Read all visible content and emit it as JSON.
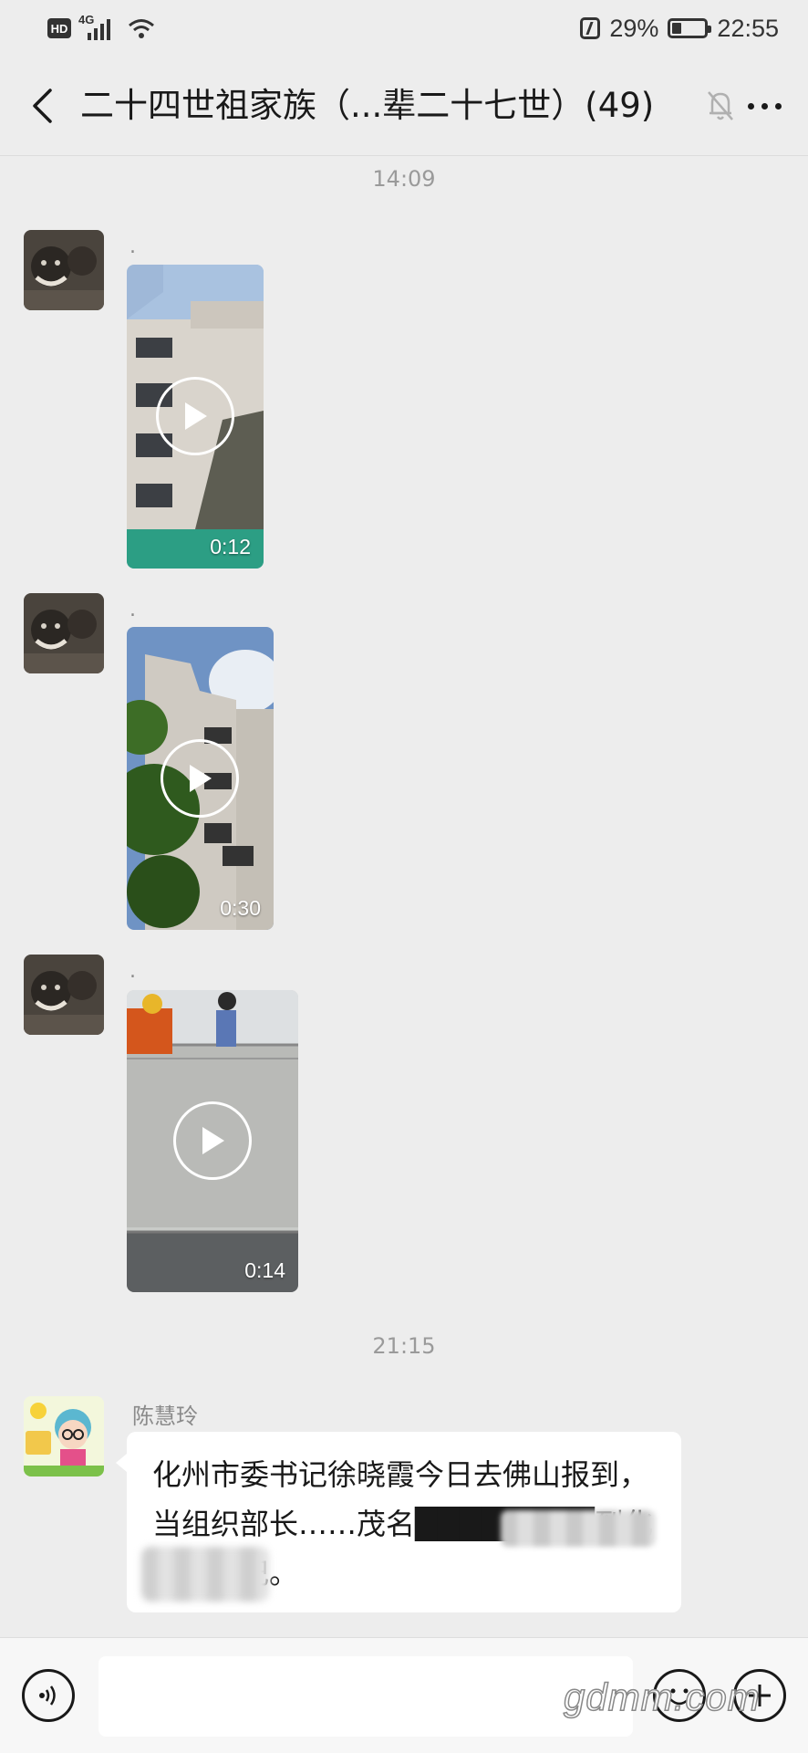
{
  "status_bar": {
    "hd_label": "HD",
    "network_label": "4G",
    "battery_percent": "29%",
    "battery_level": 0.29,
    "time": "22:55",
    "icons": [
      "hd-icon",
      "signal-icon",
      "wifi-icon",
      "nfc-icon",
      "battery-icon"
    ]
  },
  "header": {
    "back_icon": "chevron-left-icon",
    "title": "二十四世祖家族（...辈二十七世）(49)",
    "mute_icon": "bell-off-icon",
    "more_icon": "more-dots-icon"
  },
  "messages": [
    {
      "type": "timestamp",
      "text": "14:09"
    },
    {
      "type": "video",
      "sender_name": ".",
      "duration": "0:12"
    },
    {
      "type": "video",
      "sender_name": ".",
      "duration": "0:30"
    },
    {
      "type": "video",
      "sender_name": ".",
      "duration": "0:14"
    },
    {
      "type": "timestamp",
      "text": "21:15"
    },
    {
      "type": "text",
      "sender_name": "陈慧玲",
      "text": "化州市委书记徐晓霞今日去佛山报到，当组织部长……茂名████████到化州当书记。"
    }
  ],
  "bottom_bar": {
    "voice_icon": "voice-icon",
    "input_value": "",
    "emoji_icon": "emoji-icon",
    "plus_icon": "plus-icon"
  },
  "watermark": "gdmm.com",
  "colors": {
    "background": "#ededed",
    "bubble": "#ffffff",
    "timestamp_text": "#9a9a9a",
    "name_text": "#8a8a8a"
  }
}
